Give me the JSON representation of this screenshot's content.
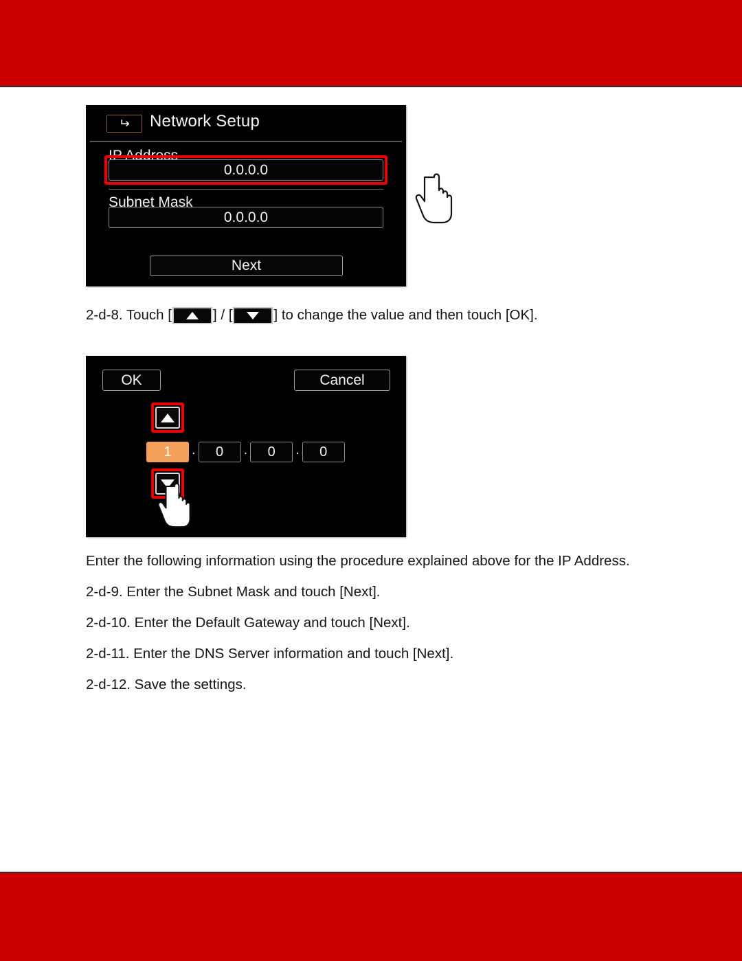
{
  "theme": {
    "banner_color": "#cc0000",
    "page_background": "#ffffff",
    "screen_background": "#000000",
    "highlight_outline_color": "#ee0000",
    "selected_digit_color": "#f5a05a",
    "back_button_border": "#8a6240"
  },
  "figure_network_setup": {
    "back_icon": "back-arrow-icon",
    "title": "Network Setup",
    "fields": [
      {
        "label": "IP Address",
        "value": "0.0.0.0",
        "highlighted": true
      },
      {
        "label": "Subnet Mask",
        "value": "0.0.0.0",
        "highlighted": false
      }
    ],
    "next_button": "Next",
    "cursor_icon": "pointing-hand-cursor"
  },
  "figure_value_editor": {
    "ok_button": "OK",
    "cancel_button": "Cancel",
    "up_arrow_icon": "triangle-up-icon",
    "down_arrow_icon": "triangle-down-icon",
    "digits": [
      "1",
      "0",
      "0",
      "0"
    ],
    "selected_digit_index": 0,
    "separator": ".",
    "cursor_icon": "pointing-hand-cursor"
  },
  "instructions": {
    "step_8": {
      "prefix": "2-d-8. Touch [",
      "middle": "] / [",
      "suffix": "] to change the value and then touch [OK].",
      "up_icon": "triangle-up-button-icon",
      "down_icon": "triangle-down-button-icon"
    },
    "intro": "Enter the following information using the procedure explained above for the IP Address.",
    "step_9": "2-d-9. Enter the Subnet Mask and touch [Next].",
    "step_10": "2-d-10. Enter the Default Gateway and touch [Next].",
    "step_11": "2-d-11. Enter the DNS Server information and touch [Next].",
    "step_12": "2-d-12. Save the settings."
  }
}
